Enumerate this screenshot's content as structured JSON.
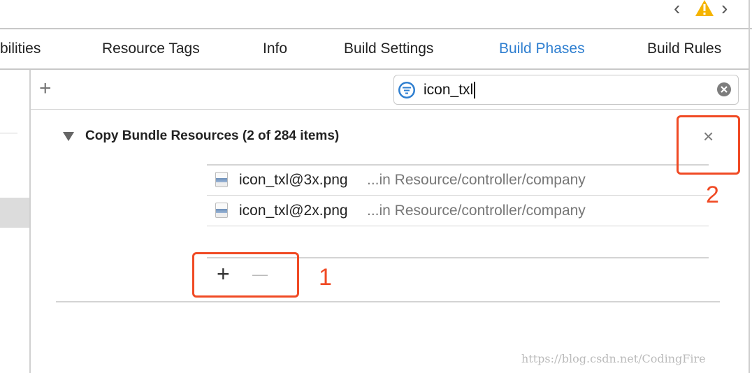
{
  "toolbar": {
    "back_icon": "chevron-left-icon",
    "warning_icon": "warning-icon",
    "forward_icon": "chevron-right-icon"
  },
  "tabs": [
    {
      "label": "bilities"
    },
    {
      "label": "Resource Tags"
    },
    {
      "label": "Info"
    },
    {
      "label": "Build Settings"
    },
    {
      "label": "Build Phases",
      "active": true
    },
    {
      "label": "Build Rules"
    }
  ],
  "filter": {
    "add_label": "+",
    "value": "icon_txl"
  },
  "section": {
    "title": "Copy Bundle Resources (2 of 284 items)",
    "close_label": "×"
  },
  "files": [
    {
      "name": "icon_txl@3x.png",
      "path": "...in Resource/controller/company"
    },
    {
      "name": "icon_txl@2x.png",
      "path": "...in Resource/controller/company"
    }
  ],
  "list_controls": {
    "add_label": "+",
    "remove_label": "—"
  },
  "annotations": {
    "one": "1",
    "two": "2"
  },
  "watermark": "https://blog.csdn.net/CodingFire",
  "colors": {
    "accent": "#2f7fd0",
    "annotation": "#f04a24",
    "warning": "#f5b400"
  }
}
